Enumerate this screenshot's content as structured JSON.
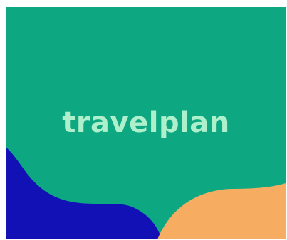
{
  "brand": {
    "name": "travelplan",
    "text_color": "#aef0cb"
  },
  "colors": {
    "background": "#0da781",
    "left_wave": "#1111b6",
    "right_wave": "#f6ad62",
    "page": "#ffffff"
  }
}
